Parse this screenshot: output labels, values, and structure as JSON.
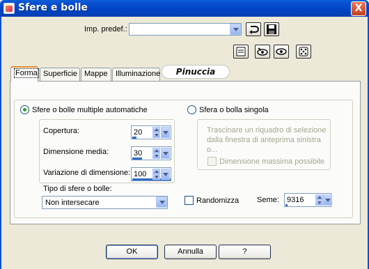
{
  "window": {
    "title": "Sfere e bolle",
    "close": "X"
  },
  "presets": {
    "label": "Imp. predef.:",
    "value": ""
  },
  "icons": {
    "app": "app-icon",
    "reset": "reset-icon",
    "save": "save-preset-icon",
    "preview": "preview-toggle-icon",
    "proof_on": "proof-eye-on-icon",
    "proof_off": "proof-eye-off-icon",
    "randomize": "dice-icon"
  },
  "tabs": [
    {
      "label": "Forma",
      "active": true
    },
    {
      "label": "Superficie",
      "active": false
    },
    {
      "label": "Mappe",
      "active": false
    },
    {
      "label": "Illuminazione",
      "active": false
    }
  ],
  "logo_text": "Pinuccia",
  "auto": {
    "radio_label": "Sfere o bolle multiple automatiche",
    "coverage_label": "Copertura:",
    "coverage_value": "20",
    "size_label": "Dimensione media:",
    "size_value": "30",
    "variation_label": "Variazione di dimensione:",
    "variation_value": "100",
    "type_label": "Tipo di sfere o bolle:",
    "type_value": "Non intersecare"
  },
  "single": {
    "radio_label": "Sfera o bolla singola",
    "hint": "Trascinare un riquadro di selezione dalla finestra di anteprima sinistra o...",
    "max_size_label": "Dimensione massima possibile"
  },
  "randomize_label": "Randomizza",
  "seed_label": "Seme:",
  "seed_value": "9316",
  "buttons": {
    "ok": "OK",
    "cancel": "Annulla",
    "help": "?"
  },
  "accent_colors": {
    "titlebar": "#0a4fd0",
    "tab_highlight": "#e68b2c",
    "bar": "#316ac5"
  }
}
